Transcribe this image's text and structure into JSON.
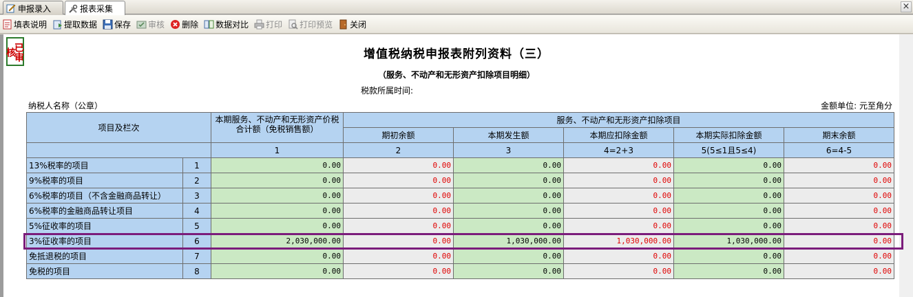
{
  "tabs": [
    {
      "label": "申报录入",
      "icon": "edit-form-icon"
    },
    {
      "label": "报表采集",
      "icon": "tools-icon"
    }
  ],
  "tab_close": "×",
  "toolbar": [
    {
      "label": "填表说明",
      "icon": "instructions-icon",
      "enabled": true
    },
    {
      "label": "提取数据",
      "icon": "extract-data-icon",
      "enabled": true
    },
    {
      "label": "保存",
      "icon": "save-icon",
      "enabled": true
    },
    {
      "label": "审核",
      "icon": "audit-icon",
      "enabled": false
    },
    {
      "label": "删除",
      "icon": "delete-icon",
      "enabled": true
    },
    {
      "label": "数据对比",
      "icon": "compare-icon",
      "enabled": true
    },
    {
      "label": "打印",
      "icon": "print-icon",
      "enabled": false
    },
    {
      "label": "打印预览",
      "icon": "print-preview-icon",
      "enabled": false
    },
    {
      "label": "关闭",
      "icon": "close-door-icon",
      "enabled": true
    }
  ],
  "stamp": "已审核",
  "form": {
    "title": "增值税纳税申报表附列资料（三）",
    "subtitle": "（服务、不动产和无形资产扣除项目明细）",
    "period_label": "税款所属时间:",
    "taxpayer_label": "纳税人名称（公章）",
    "unit_label": "金额单位: 元至角分"
  },
  "table": {
    "header_item": "项目及栏次",
    "header_total": "本期服务、不动产和无形资产价税合计额（免税销售额）",
    "header_group": "服务、不动产和无形资产扣除项目",
    "header_cols": [
      "期初余额",
      "本期发生额",
      "本期应扣除金额",
      "本期实际扣除金额",
      "期末余额"
    ],
    "col_codes": [
      "1",
      "2",
      "3",
      "4=2+3",
      "5(5≤1且5≤4)",
      "6=4-5"
    ],
    "rows": [
      {
        "label": "13%税率的项目",
        "no": "1",
        "values": [
          "0.00",
          "0.00",
          "0.00",
          "0.00",
          "0.00",
          "0.00"
        ]
      },
      {
        "label": "9%税率的项目",
        "no": "2",
        "values": [
          "0.00",
          "0.00",
          "0.00",
          "0.00",
          "0.00",
          "0.00"
        ]
      },
      {
        "label": "6%税率的项目（不含金融商品转让）",
        "no": "3",
        "values": [
          "0.00",
          "0.00",
          "0.00",
          "0.00",
          "0.00",
          "0.00"
        ]
      },
      {
        "label": "6%税率的金融商品转让项目",
        "no": "4",
        "values": [
          "0.00",
          "0.00",
          "0.00",
          "0.00",
          "0.00",
          "0.00"
        ]
      },
      {
        "label": "5%征收率的项目",
        "no": "5",
        "values": [
          "0.00",
          "0.00",
          "0.00",
          "0.00",
          "0.00",
          "0.00"
        ]
      },
      {
        "label": "3%征收率的项目",
        "no": "6",
        "values": [
          "2,030,000.00",
          "0.00",
          "1,030,000.00",
          "1,030,000.00",
          "1,030,000.00",
          "0.00"
        ]
      },
      {
        "label": "免抵退税的项目",
        "no": "7",
        "values": [
          "0.00",
          "0.00",
          "0.00",
          "0.00",
          "0.00",
          "0.00"
        ]
      },
      {
        "label": "免税的项目",
        "no": "8",
        "values": [
          "0.00",
          "0.00",
          "0.00",
          "0.00",
          "0.00",
          "0.00"
        ]
      }
    ],
    "highlighted_row": 6
  },
  "colors": {
    "header_bg": "#b5d3f1",
    "editable_bg": "#cbe9c4",
    "readonly_bg": "#ececec",
    "negative_text": "#e00000",
    "highlight_border": "#7b1c7b"
  }
}
